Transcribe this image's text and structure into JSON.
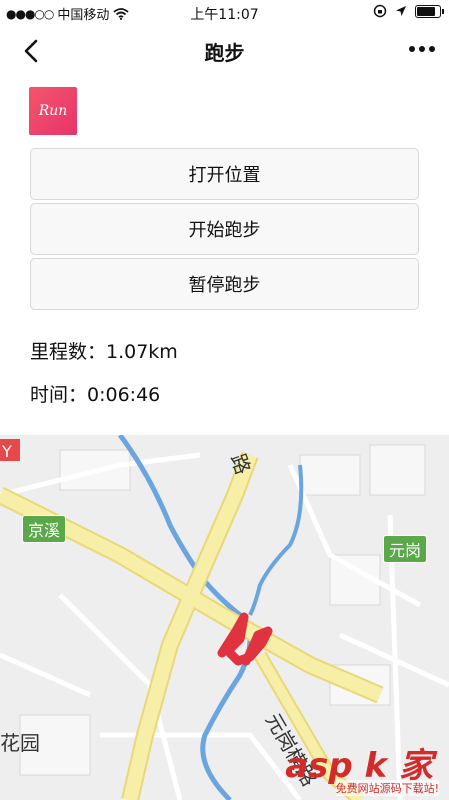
{
  "status_bar": {
    "signal_dots": "●●●○○",
    "carrier": "中国移动",
    "time": "上午11:07"
  },
  "nav": {
    "title": "跑步"
  },
  "logo": {
    "text": "Run"
  },
  "buttons": {
    "open_location": "打开位置",
    "start_run": "开始跑步",
    "pause_run": "暂停跑步"
  },
  "stats": {
    "distance": "里程数：1.07km",
    "time": "时间：0:06:46"
  },
  "map": {
    "labels": {
      "jingxi": "京溪",
      "yuangang": "元岗",
      "yuan": "花园",
      "road_top": "路",
      "road_bottom": "元岗横路"
    }
  },
  "watermark": {
    "main": "asp k 家",
    "sub": "免费网站源码下载站!"
  },
  "colors": {
    "logo_gradient": "#e8336b",
    "route": "#e0333f",
    "map_label": "#5aa84a",
    "river": "#6aa5e0",
    "main_road": "#f3e690"
  }
}
